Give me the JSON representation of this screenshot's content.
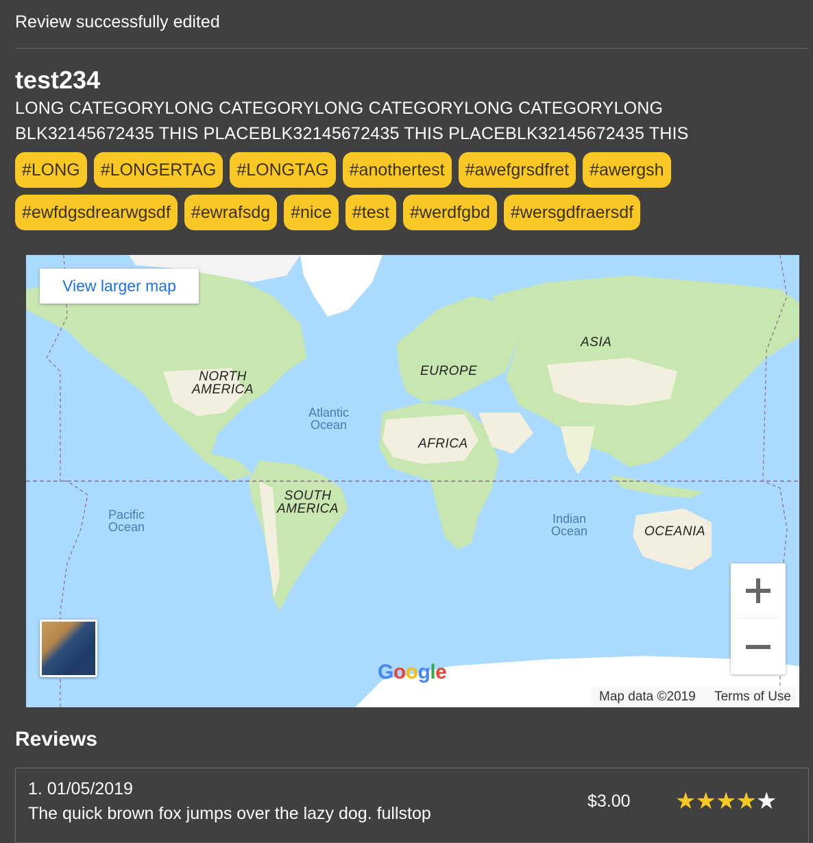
{
  "notice": "Review successfully edited",
  "place": {
    "title": "test234",
    "category_line1": "LONG CATEGORYLONG CATEGORYLONG CATEGORYLONG CATEGORYLONG",
    "category_line2": "BLK32145672435 THIS PLACEBLK32145672435 THIS PLACEBLK32145672435 THIS"
  },
  "tags": [
    "#LONG",
    "#LONGERTAG",
    "#LONGTAG",
    "#anothertest",
    "#awefgrsdfret",
    "#awergsh",
    "#ewfdgsdrearwgsdf",
    "#ewrafsdg",
    "#nice",
    "#test",
    "#werdfgbd",
    "#wersgdfraersdf"
  ],
  "map": {
    "view_larger": "View larger map",
    "continents": {
      "north_america_1": "NORTH",
      "north_america_2": "AMERICA",
      "south_america_1": "SOUTH",
      "south_america_2": "AMERICA",
      "europe": "EUROPE",
      "africa": "AFRICA",
      "asia": "ASIA",
      "oceania": "OCEANIA"
    },
    "oceans": {
      "atlantic_1": "Atlantic",
      "atlantic_2": "Ocean",
      "pacific_1": "Pacific",
      "pacific_2": "Ocean",
      "indian_1": "Indian",
      "indian_2": "Ocean"
    },
    "logo": "Google",
    "attribution": "Map data ©2019",
    "terms": "Terms of Use",
    "zoom_in_icon": "plus-icon",
    "zoom_out_icon": "minus-icon",
    "colors": {
      "water": "#aadaff",
      "land": "#c8e6b0",
      "desert": "#f2efdf",
      "ice": "#ffffff"
    }
  },
  "reviews": {
    "heading": "Reviews",
    "items": [
      {
        "date": "1. 01/05/2019",
        "text": "The quick brown fox jumps over the lazy dog. fullstop",
        "price": "$3.00",
        "rating": 4,
        "max_rating": 5
      }
    ]
  },
  "colors": {
    "background": "#404040",
    "tag_bg": "#f9c824",
    "star": "#f9c824"
  }
}
